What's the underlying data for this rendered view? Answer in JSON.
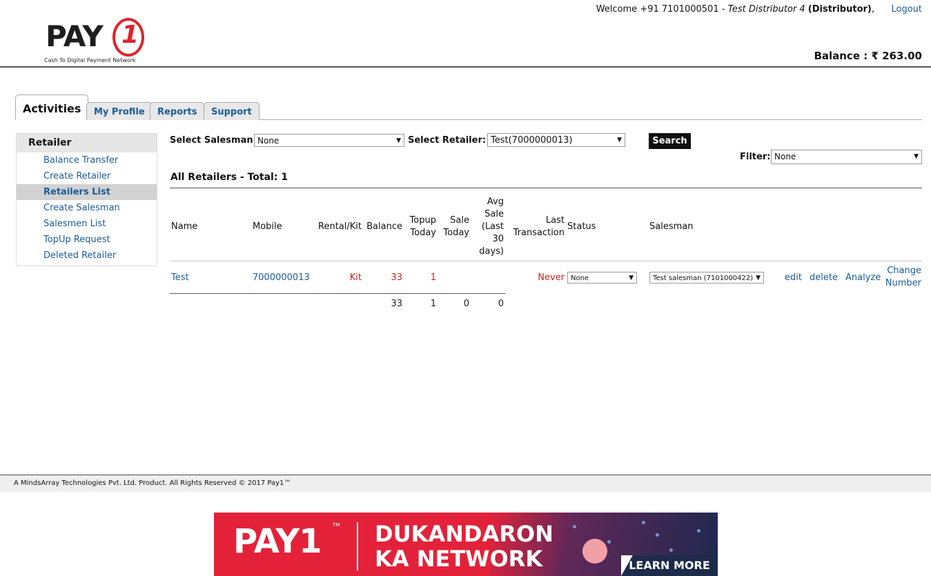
{
  "header": {
    "welcome_prefix": "Welcome +91 7101000501 - ",
    "user_name": "Test Distributor 4",
    "user_role": "(Distributor)",
    "welcome_suffix": ",",
    "logout_label": "Logout",
    "logo_word": "PAY",
    "logo_one": "1",
    "logo_tagline": "Cash To Digital Payment Network",
    "balance_label": "Balance : ₹ 263.00"
  },
  "tabs": [
    {
      "label": "Activities",
      "active": true
    },
    {
      "label": "My Profile",
      "active": false
    },
    {
      "label": "Reports",
      "active": false
    },
    {
      "label": "Support",
      "active": false
    }
  ],
  "sidebar": {
    "heading": "Retailer",
    "items": [
      {
        "label": "Balance Transfer"
      },
      {
        "label": "Create Retailer"
      },
      {
        "label": "Retailers List",
        "active": true
      },
      {
        "label": "Create Salesman"
      },
      {
        "label": "Salesmen List"
      },
      {
        "label": "TopUp Request"
      },
      {
        "label": "Deleted Retailer"
      }
    ]
  },
  "filters": {
    "salesman_label": "Select Salesman:",
    "salesman_value": "None",
    "retailer_label": "Select Retailer:",
    "retailer_value": "Test(7000000013)",
    "search_label": "Search",
    "filter_label": "Filter:",
    "filter_value": "None"
  },
  "list": {
    "title": "All Retailers - Total: 1",
    "headers": {
      "name": "Name",
      "mobile": "Mobile",
      "rental_kit": "Rental/Kit",
      "balance": "Balance",
      "topup_today_1": "Topup",
      "topup_today_2": "Today",
      "sale_today_1": "Sale",
      "sale_today_2": "Today",
      "avg_sale_1": "Avg",
      "avg_sale_2": "Sale",
      "avg_sale_3": "(Last",
      "avg_sale_4": "30",
      "avg_sale_5": "days)",
      "last_txn_1": "Last",
      "last_txn_2": "Transaction",
      "status": "Status",
      "salesman": "Salesman"
    },
    "row": {
      "name": "Test",
      "mobile": "7000000013",
      "rental_kit": "Kit",
      "balance": "33",
      "topup_today": "1",
      "last_transaction": "Never",
      "status_value": "None",
      "salesman_value": "Test salesman (7101000422)",
      "action_edit": "edit",
      "action_delete": "delete",
      "action_analyze": "Analyze",
      "action_change_1": "Change",
      "action_change_2": "Number"
    },
    "totals": {
      "balance": "33",
      "topup_today": "1",
      "sale_today": "0",
      "avg_sale": "0"
    }
  },
  "footer": {
    "text": "A MindsArray Technologies Pvt. Ltd. Product. All Rights Reserved © 2017 Pay1™"
  },
  "banner": {
    "logo": "PAY1",
    "tm": "TM",
    "line1": "DUKANDARON",
    "line2": "KA NETWORK",
    "cta": "LEARN MORE"
  },
  "colors": {
    "brand_red": "#e1222b",
    "link_blue": "#1a5b9a",
    "value_red": "#d0201b"
  }
}
